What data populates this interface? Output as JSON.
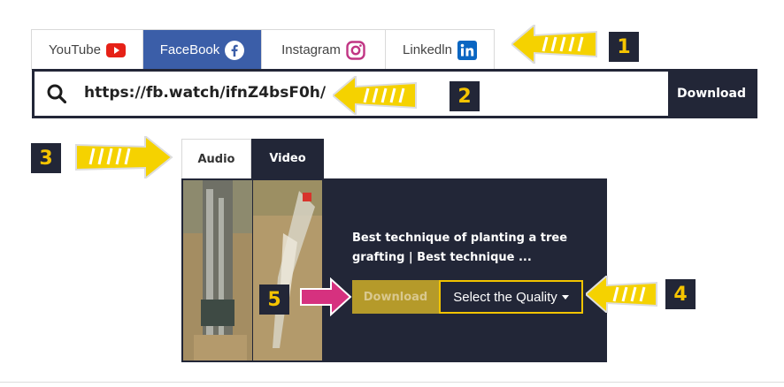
{
  "platform_tabs": [
    {
      "label": "YouTube",
      "icon": "youtube-icon"
    },
    {
      "label": "FaceBook",
      "icon": "facebook-icon",
      "active": true
    },
    {
      "label": "Instagram",
      "icon": "instagram-icon"
    },
    {
      "label": "Linkedln",
      "icon": "linkedin-icon"
    }
  ],
  "url_bar": {
    "value": "https://fb.watch/ifnZ4bsF0h/",
    "download_label": "Download"
  },
  "media_tabs": [
    {
      "label": "Audio"
    },
    {
      "label": "Video",
      "active": true
    }
  ],
  "result": {
    "title": "Best technique of planting a tree grafting | Best technique ...",
    "download_label": "Download",
    "quality_label": "Select the Quality"
  },
  "annotations": [
    "1",
    "2",
    "3",
    "4",
    "5"
  ],
  "colors": {
    "navy": "#222637",
    "facebook_blue": "#3b5ea8",
    "gold": "#b59a2a",
    "highlight_yellow": "#f2c400",
    "arrow_pink": "#d6317f"
  }
}
